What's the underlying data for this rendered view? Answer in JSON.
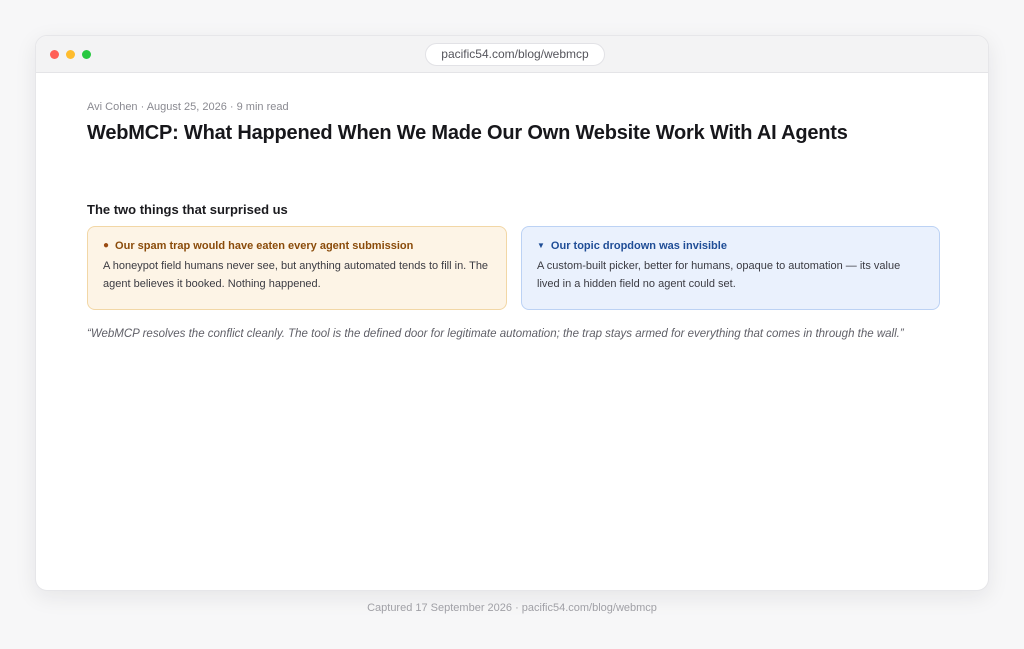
{
  "browser": {
    "url": "pacific54.com/blog/webmcp"
  },
  "article": {
    "meta": "Avi Cohen · August 25, 2026 · 9 min read",
    "title": "WebMCP: What Happened When We Made Our Own Website Work With AI Agents",
    "section_heading": "The two things that surprised us",
    "cards": [
      {
        "icon": "jar-icon",
        "icon_glyph": "●",
        "title": "Our spam trap would have eaten every agent submission",
        "body": "A honeypot field humans never see, but anything automated tends to fill in. The agent believes it booked. Nothing happened.",
        "accent": "#8a4b0a"
      },
      {
        "icon": "dropdown-caret-icon",
        "icon_glyph": "▼",
        "title": "Our topic dropdown was invisible",
        "body": "A custom-built picker, better for humans, opaque to automation — its value lived in a hidden field no agent could set.",
        "accent": "#1f4d96"
      }
    ],
    "quote": "“WebMCP resolves the conflict cleanly. The tool is the defined door for legitimate automation; the trap stays armed for everything that comes in through the wall.”"
  },
  "footer": {
    "caption": "Captured 17 September 2026 · pacific54.com/blog/webmcp"
  }
}
